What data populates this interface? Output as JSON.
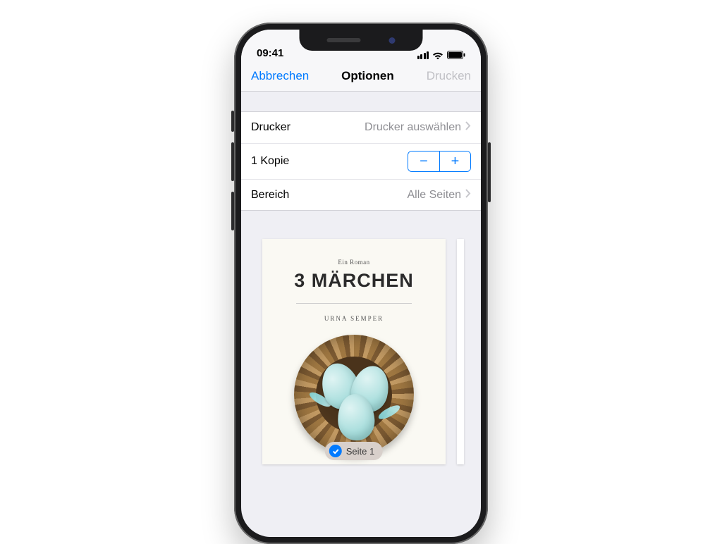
{
  "statusbar": {
    "time": "09:41"
  },
  "nav": {
    "cancel": "Abbrechen",
    "title": "Optionen",
    "print": "Drucken"
  },
  "rows": {
    "printer_label": "Drucker",
    "printer_value": "Drucker auswählen",
    "copies_label": "1 Kopie",
    "range_label": "Bereich",
    "range_value": "Alle Seiten"
  },
  "preview": {
    "subtitle": "Ein Roman",
    "title": "3 MÄRCHEN",
    "author": "URNA SEMPER",
    "page_tag": "Seite 1"
  },
  "colors": {
    "ios_blue": "#007aff",
    "egg": "#a9dedd"
  }
}
